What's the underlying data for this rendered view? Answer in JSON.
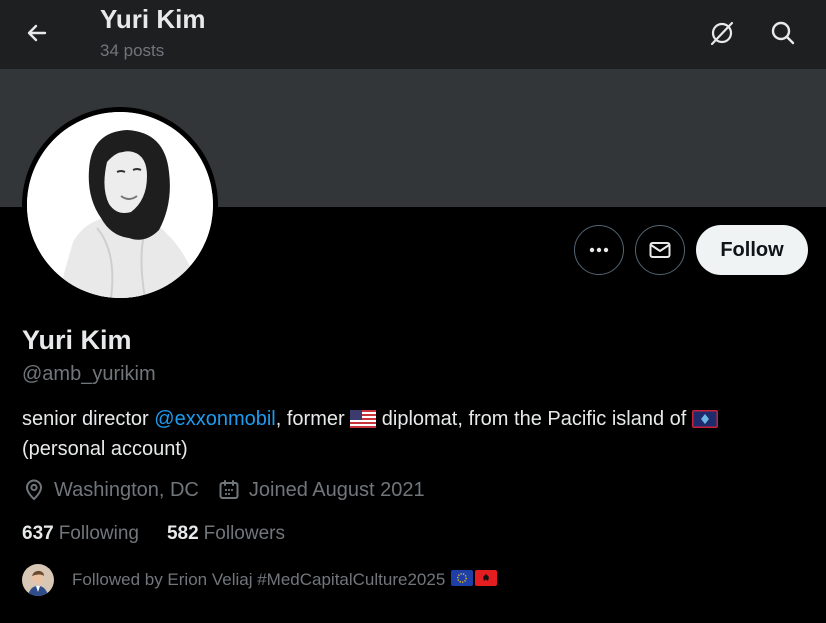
{
  "header": {
    "name": "Yuri Kim",
    "posts": "34 posts"
  },
  "actions": {
    "follow_label": "Follow"
  },
  "profile": {
    "name": "Yuri Kim",
    "handle": "@amb_yurikim",
    "bio": {
      "part1": "senior director ",
      "mention": "@exxonmobil",
      "part2": ", former ",
      "part3": " diplomat, from the Pacific island of ",
      "line2": "(personal account)"
    },
    "location": "Washington, DC",
    "joined": "Joined August 2021",
    "following_count": "637",
    "following_label": "Following",
    "followers_count": "582",
    "followers_label": "Followers",
    "followed_by": "Followed by Erion Veliaj #MedCapitalCulture2025"
  },
  "icons": {
    "back": "arrow-left-icon",
    "unavailable": "circle-slash-icon",
    "search": "search-icon",
    "more": "ellipsis-icon",
    "message": "envelope-icon",
    "location": "location-pin-icon",
    "calendar": "calendar-icon"
  },
  "colors": {
    "background": "#000000",
    "banner": "#333639",
    "topbar": "#1d1f21",
    "link": "#1d9bf0",
    "muted": "#71767b",
    "text": "#e7e9ea",
    "follow_bg": "#eff3f4"
  }
}
